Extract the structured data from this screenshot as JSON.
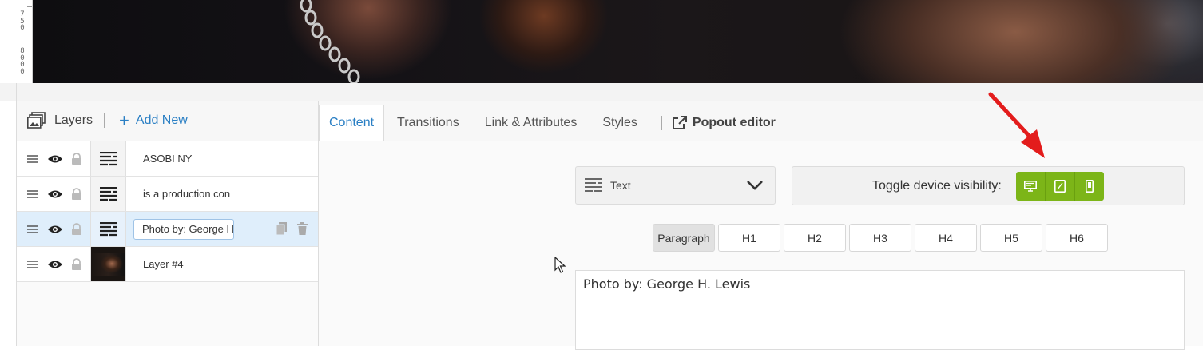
{
  "ruler": {
    "ticks_a": [
      "7",
      "5",
      "0"
    ],
    "ticks_b": [
      "8",
      "0",
      "0",
      "0"
    ]
  },
  "layers": {
    "title": "Layers",
    "add_new": "Add New",
    "items": [
      {
        "name": "ASOBI NY",
        "thumb": "text-icon"
      },
      {
        "name": "is a production con",
        "thumb": "text-icon"
      },
      {
        "name": "Photo by: George H",
        "thumb": "text-icon",
        "selected": true
      },
      {
        "name": "Layer #4",
        "thumb": "image-thumbnail"
      }
    ]
  },
  "tabs": {
    "items": [
      "Content",
      "Transitions",
      "Link & Attributes",
      "Styles"
    ],
    "popout": "Popout editor"
  },
  "content": {
    "type_select": "Text",
    "device_visibility_label": "Toggle device visibility:",
    "device_buttons": [
      "desktop-icon",
      "tablet-icon",
      "mobile-icon"
    ],
    "device_color": "#7cb518",
    "heading_buttons": [
      "Paragraph",
      "H1",
      "H2",
      "H3",
      "H4",
      "H5",
      "H6"
    ],
    "text_value": "Photo by: George H. Lewis"
  },
  "accent_color": "#2a7fc4",
  "annotation_color": "#e31c1c"
}
